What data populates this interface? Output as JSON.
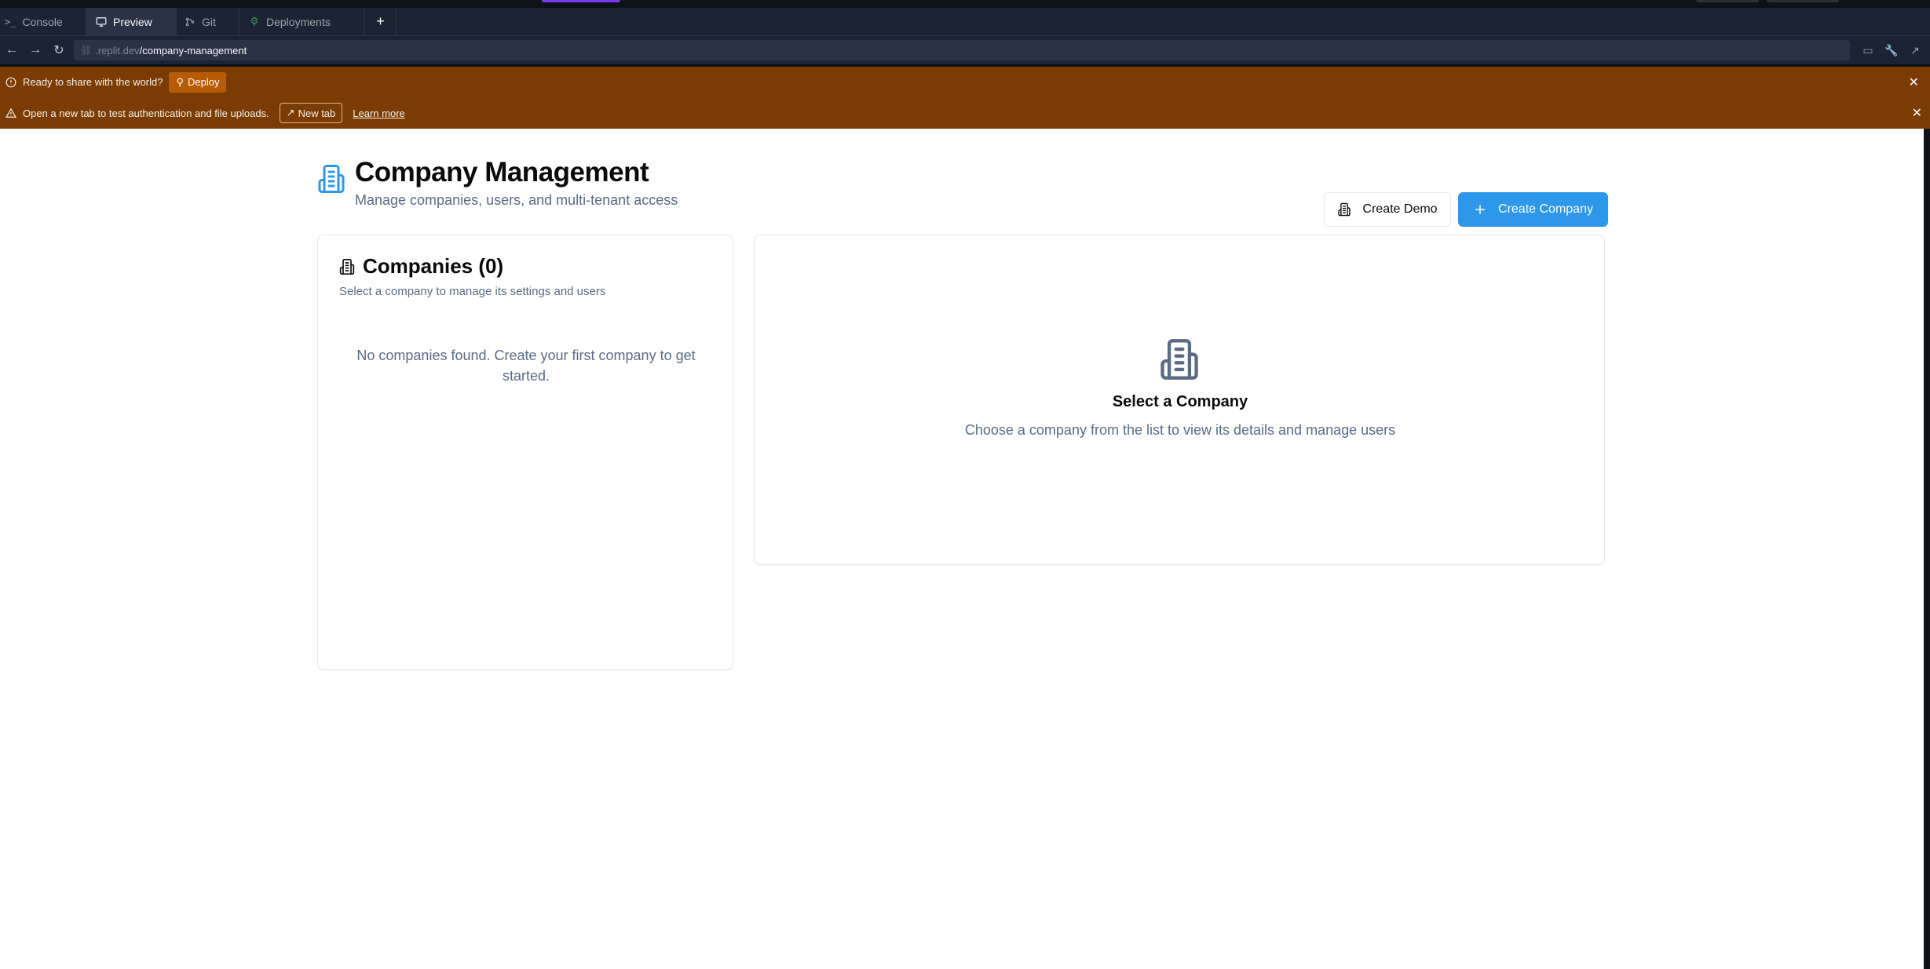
{
  "tabs": [
    {
      "icon": "terminal-icon",
      "label": "Console",
      "active": false
    },
    {
      "icon": "monitor-icon",
      "label": "Preview",
      "active": true
    },
    {
      "icon": "git-branch-icon",
      "label": "Git",
      "active": false
    },
    {
      "icon": "deployments-icon",
      "label": "Deployments",
      "active": false
    }
  ],
  "tab_add_label": "+",
  "url": {
    "host": ".replit.dev",
    "path": "/company-management"
  },
  "banners": {
    "deploy": {
      "message": "Ready to share with the world?",
      "button": "Deploy"
    },
    "newtab": {
      "message": "Open a new tab to test authentication and file uploads.",
      "button": "New tab",
      "link": "Learn more"
    }
  },
  "page": {
    "title": "Company Management",
    "subtitle": "Manage companies, users, and multi-tenant access",
    "demo_button": "Create Demo",
    "create_button": "Create Company"
  },
  "companies_panel": {
    "title": "Companies (0)",
    "subtitle": "Select a company to manage its settings and users",
    "empty_text": "No companies found. Create your first company to get started."
  },
  "detail_panel": {
    "title": "Select a Company",
    "subtitle": "Choose a company from the list to view its details and manage users"
  },
  "colors": {
    "accent": "#2d97ea",
    "banner_bg": "#7a3c02",
    "deploy_btn": "#b85b05",
    "ide_bg": "#1c2333",
    "muted_text": "#5b6b84"
  }
}
